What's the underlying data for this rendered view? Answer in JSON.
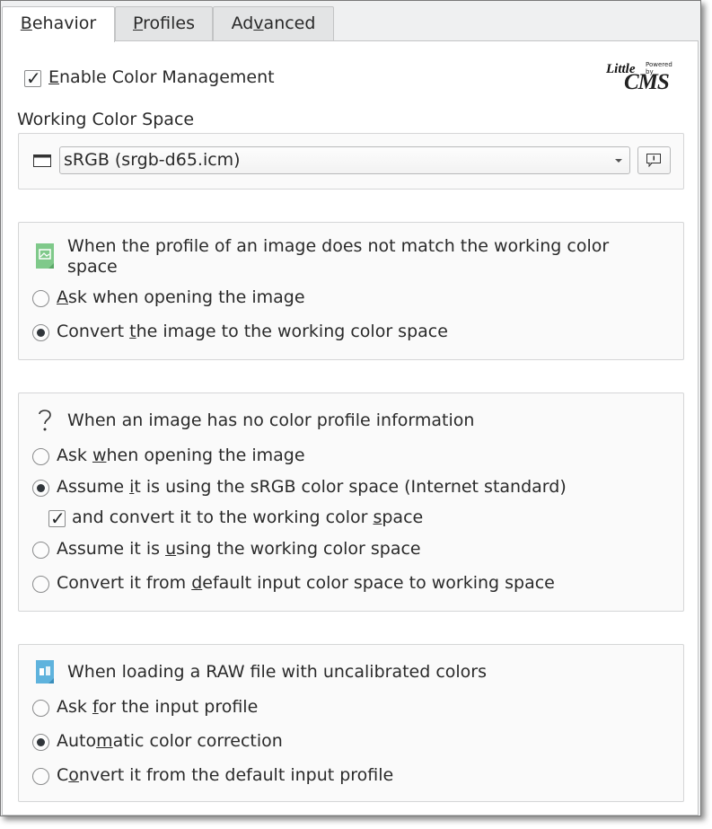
{
  "tabs": [
    {
      "pre": "",
      "u": "B",
      "post": "ehavior"
    },
    {
      "pre": "",
      "u": "P",
      "post": "rofiles"
    },
    {
      "pre": "Ad",
      "u": "v",
      "post": "anced"
    }
  ],
  "enable_cm": {
    "pre": "",
    "u": "E",
    "post": "nable Color Management",
    "checked": true
  },
  "logo": {
    "line1": "Little",
    "line2": "CMS",
    "powered": "Powered by"
  },
  "working_space": {
    "label": "Working Color Space",
    "value": "sRGB (srgb-d65.icm)"
  },
  "mismatch": {
    "title": "When the profile of an image does not match the working color",
    "title2": "space",
    "opt1": {
      "pre": "",
      "u": "A",
      "post": "sk when opening the image"
    },
    "opt2": {
      "pre": "Convert ",
      "u": "t",
      "post": "he image to the working color space"
    }
  },
  "noprofile": {
    "title": "When an image has no color profile information",
    "opt1": {
      "pre": "Ask ",
      "u": "w",
      "post": "hen opening the image"
    },
    "opt2": {
      "pre": "Assume ",
      "u": "i",
      "post": "t is using the sRGB color space (Internet standard)"
    },
    "sub": {
      "pre": "and convert it to the working color ",
      "u": "s",
      "post": "pace"
    },
    "opt3": {
      "pre": "Assume it is ",
      "u": "u",
      "post": "sing the working color space"
    },
    "opt4": {
      "pre": "Convert it from ",
      "u": "d",
      "post": "efault input color space to working space"
    }
  },
  "raw": {
    "title": "When loading a RAW file with uncalibrated colors",
    "opt1": {
      "pre": "Ask ",
      "u": "f",
      "post": "or the input profile"
    },
    "opt2": {
      "pre": "Auto",
      "u": "m",
      "post": "atic color correction"
    },
    "opt3": {
      "pre": "C",
      "u": "o",
      "post": "nvert it from the default input profile"
    }
  },
  "colors": {
    "accent": "#3daee9",
    "radio_fill": "#31363b",
    "panel_bg": "#ffffff",
    "window_bg": "#eff0f1"
  }
}
